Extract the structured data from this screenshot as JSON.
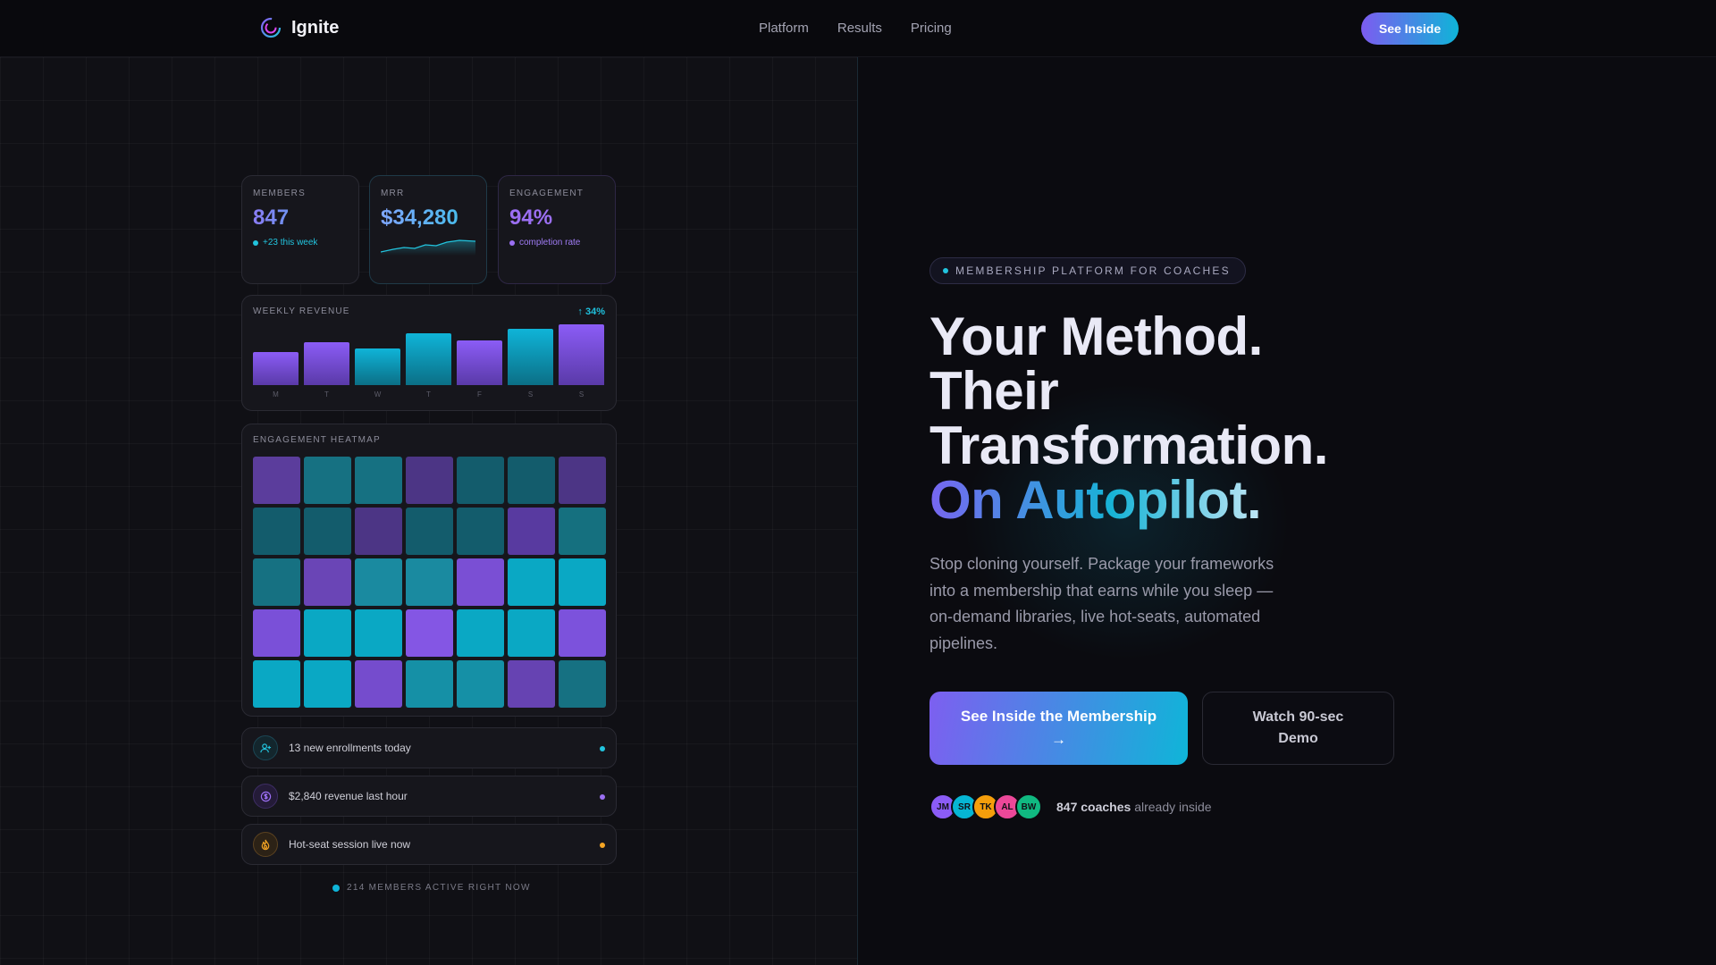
{
  "nav": {
    "brand": "Ignite",
    "links": [
      "Platform",
      "Results",
      "Pricing"
    ],
    "cta": "See Inside"
  },
  "dashboard": {
    "stats": [
      {
        "label": "MEMBERS",
        "value": "847",
        "sub": "+23 this week"
      },
      {
        "label": "MRR",
        "value": "$34,280"
      },
      {
        "label": "ENGAGEMENT",
        "value": "94%",
        "sub": "completion rate"
      }
    ],
    "revenue": {
      "title": "WEEKLY REVENUE",
      "change": "↑ 34%",
      "days": [
        "M",
        "T",
        "W",
        "T",
        "F",
        "S",
        "S"
      ],
      "levels": [
        0.55,
        0.7,
        0.6,
        0.86,
        0.74,
        0.93,
        1.0
      ],
      "colors": [
        "purple",
        "purple",
        "cyan",
        "cyan",
        "purple",
        "cyan",
        "purple"
      ]
    },
    "heatmap": {
      "title": "ENGAGEMENT HEATMAP",
      "cells": [
        [
          "#5b3d9c",
          "#167182",
          "#167182",
          "#4c3585",
          "#135c6c",
          "#135c6c",
          "#4c3585"
        ],
        [
          "#135c6c",
          "#135c6c",
          "#4c3585",
          "#135c6c",
          "#135c6c",
          "#583aa0",
          "#15707f"
        ],
        [
          "#167182",
          "#6a45b6",
          "#1a8aa0",
          "#1a8aa0",
          "#7a4fd4",
          "#0aa8c4",
          "#0aa8c4"
        ],
        [
          "#7a50d8",
          "#0aa8c4",
          "#0aa8c4",
          "#8456e4",
          "#0aa8c4",
          "#0aa8c4",
          "#7c52dc"
        ],
        [
          "#0aa8c4",
          "#0aa8c4",
          "#754ccd",
          "#1590a6",
          "#1590a6",
          "#6643b2",
          "#167182"
        ]
      ]
    },
    "feed": [
      {
        "text": "13 new enrollments today",
        "icon": "user-plus-icon",
        "color": "#22c4de"
      },
      {
        "text": "$2,840 revenue last hour",
        "icon": "dollar-icon",
        "color": "#9b6ff2"
      },
      {
        "text": "Hot-seat session live now",
        "icon": "flame-icon",
        "color": "#f5a524"
      }
    ],
    "active": "214 MEMBERS ACTIVE RIGHT NOW"
  },
  "hero": {
    "badge": "MEMBERSHIP PLATFORM FOR COACHES",
    "line1": "Your Method.",
    "line2": "Their",
    "line3": "Transformation.",
    "line4": "On Autopilot.",
    "description": "Stop cloning yourself. Package your frameworks into a membership that earns while you sleep — on-demand libraries, live hot-seats, automated pipelines.",
    "cta_primary": "See Inside the Membership",
    "cta_arrow": "→",
    "cta_secondary_1": "Watch 90-sec",
    "cta_secondary_2": "Demo",
    "avatars": [
      {
        "initials": "JM",
        "color": "#8b5cf6"
      },
      {
        "initials": "SR",
        "color": "#06b6d4"
      },
      {
        "initials": "TK",
        "color": "#f59e0b"
      },
      {
        "initials": "AL",
        "color": "#ec4899"
      },
      {
        "initials": "BW",
        "color": "#10b981"
      }
    ],
    "social_count": "847 coaches",
    "social_suffix": "already inside"
  }
}
